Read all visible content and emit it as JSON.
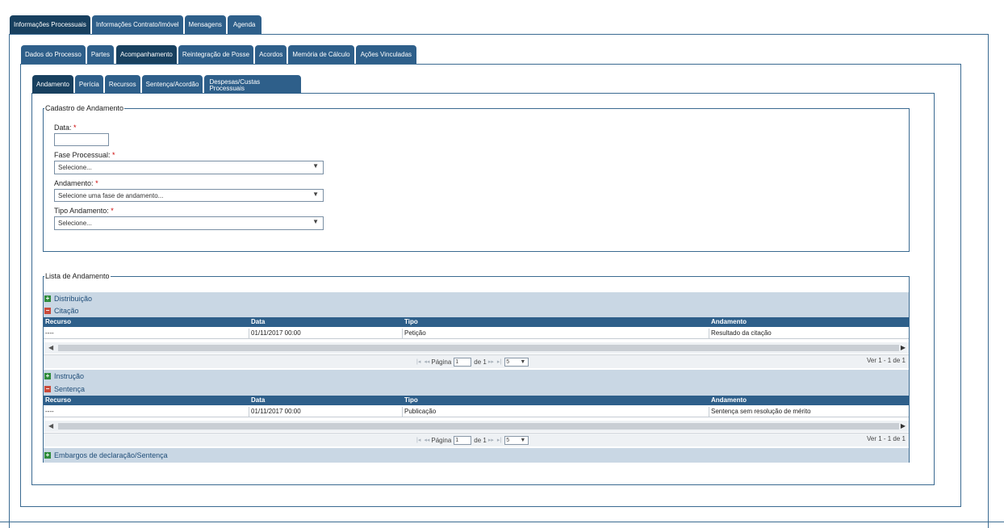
{
  "top_tabs": [
    "Informações Processuais",
    "Informações Contrato/Imóvel",
    "Mensagens",
    "Agenda"
  ],
  "sub_tabs": [
    "Dados do Processo",
    "Partes",
    "Acompanhamento",
    "Reintegração de Posse",
    "Acordos",
    "Memória de Cálculo",
    "Ações Vinculadas"
  ],
  "third_tabs": [
    "Andamento",
    "Perícia",
    "Recursos",
    "Sentença/Acordão",
    "Despesas/Custas Processuais"
  ],
  "form": {
    "legend": "Cadastro de Andamento",
    "data_label": "Data:",
    "fase_label": "Fase Processual:",
    "fase_value": "Selecione...",
    "andamento_label": "Andamento:",
    "andamento_value": "Selecione uma fase de andamento...",
    "tipo_label": "Tipo Andamento:",
    "tipo_value": "Selecione...",
    "required_mark": "*"
  },
  "list": {
    "legend": "Lista de Andamento",
    "columns": [
      "Recurso",
      "Data",
      "Tipo",
      "Andamento"
    ],
    "groups": [
      "Distribuição",
      "Citação",
      "Instrução",
      "Sentença",
      "Embargos de declaração/Sentença"
    ],
    "citacao_row": [
      "----",
      "01/11/2017 00:00",
      "Petição",
      "Resultado da citação"
    ],
    "sentenca_row": [
      "----",
      "01/11/2017 00:00",
      "Publicação",
      "Sentença sem resolução de mérito"
    ],
    "pager": {
      "page_label": "Página",
      "page_value": "1",
      "of_label": "de 1",
      "page_size": "5",
      "summary": "Ver 1 - 1 de 1"
    }
  },
  "icons": {
    "expand": "plus-icon",
    "collapse": "minus-icon",
    "dropdown": "triangle-down-icon"
  },
  "colors": {
    "tab": "#2e5f8a",
    "tab_active": "#18405f",
    "group_bg": "#c9d7e4",
    "expand": "#2e8b3a",
    "collapse": "#c94a3a"
  }
}
